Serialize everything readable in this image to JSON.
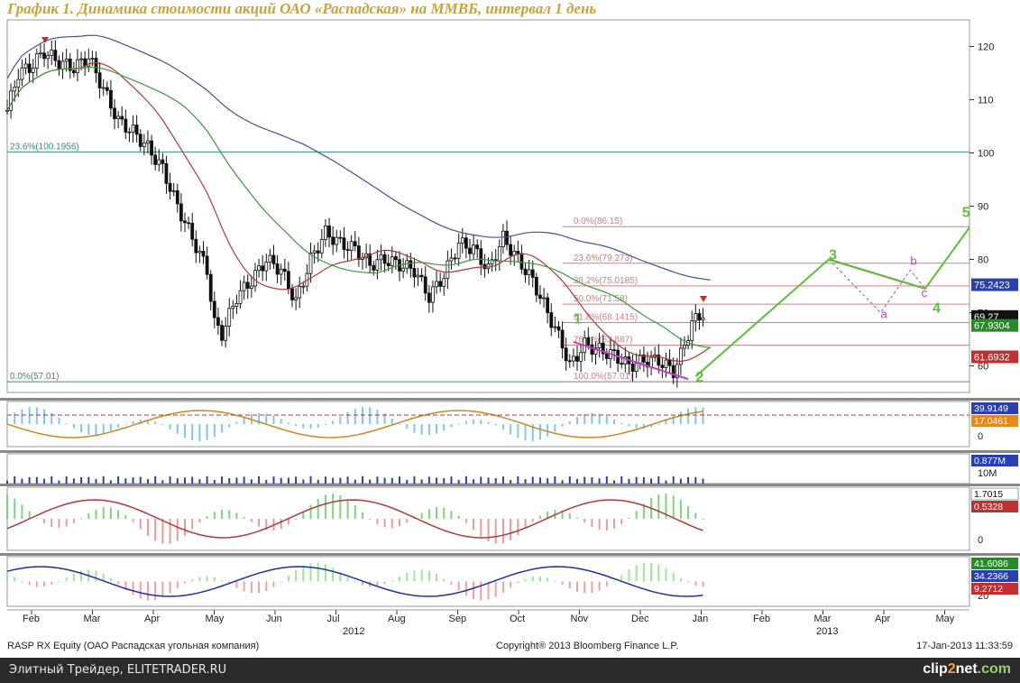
{
  "title": "График 1.   Динамика стоимости акций ОАО «Распадская» на ММВБ, интервал 1 день",
  "info": {
    "security": "RASP RX Equity (ОАО Распадская угольная компания)",
    "copyright": "Copyright® 2013 Bloomberg Finance L.P.",
    "timestamp": "17-Jan-2013 11:33:59"
  },
  "footer": {
    "left": "Элитный Трейдер, ELITETRADER.RU",
    "brand_a": "clip",
    "brand_b": "2",
    "brand_c": "net",
    "brand_d": ".com"
  },
  "colors": {
    "candle": "#111111",
    "ma_short": "#b03a3a",
    "ma_mid": "#3a9a3a",
    "ma_long": "#4050a0",
    "fib": "#d08080",
    "wave": "#5cbf3a",
    "alt_wave": "#c040c0",
    "level_line": "#3a8a8a",
    "tag_blue": "#2a40b0",
    "tag_red": "#c03030",
    "tag_green": "#2a8a2a",
    "tag_orange": "#e08a20"
  },
  "chart_data": {
    "type": "candlestick",
    "price_axis": {
      "ylim": [
        55,
        125
      ],
      "ticks": [
        60,
        70,
        80,
        90,
        100,
        110,
        120
      ]
    },
    "month_labels": [
      "Feb",
      "Mar",
      "Apr",
      "May",
      "Jun",
      "Jul",
      "Aug",
      "Sep",
      "Oct",
      "Nov",
      "Dec",
      "Jan",
      "Feb",
      "Mar",
      "Apr",
      "May"
    ],
    "year_labels": [
      "2012",
      "2013"
    ],
    "close_path": [
      [
        0,
        108
      ],
      [
        3,
        115
      ],
      [
        6,
        116
      ],
      [
        10,
        119
      ],
      [
        14,
        117
      ],
      [
        18,
        116
      ],
      [
        22,
        118
      ],
      [
        26,
        112
      ],
      [
        30,
        106
      ],
      [
        34,
        104
      ],
      [
        38,
        101
      ],
      [
        42,
        97
      ],
      [
        46,
        90
      ],
      [
        50,
        84
      ],
      [
        54,
        78
      ],
      [
        56,
        68
      ],
      [
        58,
        66
      ],
      [
        62,
        73
      ],
      [
        66,
        76
      ],
      [
        70,
        80
      ],
      [
        74,
        78
      ],
      [
        78,
        72
      ],
      [
        82,
        80
      ],
      [
        86,
        85
      ],
      [
        90,
        83
      ],
      [
        94,
        82
      ],
      [
        98,
        79
      ],
      [
        102,
        80
      ],
      [
        106,
        79
      ],
      [
        110,
        78
      ],
      [
        114,
        73
      ],
      [
        118,
        77
      ],
      [
        122,
        83
      ],
      [
        126,
        82
      ],
      [
        130,
        78
      ],
      [
        134,
        84
      ],
      [
        138,
        80
      ],
      [
        142,
        76
      ],
      [
        146,
        70
      ],
      [
        150,
        64
      ],
      [
        152,
        60
      ],
      [
        156,
        64
      ],
      [
        160,
        63
      ],
      [
        164,
        62
      ],
      [
        168,
        60
      ],
      [
        172,
        61
      ],
      [
        176,
        61
      ],
      [
        180,
        59
      ],
      [
        182,
        62
      ],
      [
        185,
        68
      ],
      [
        188,
        70
      ]
    ],
    "candle_dates": [
      0,
      188
    ],
    "horizontal_levels": [
      {
        "label": "23.6%(100.1956)",
        "value": 100.1956
      },
      {
        "label": "0.0%(57.01)",
        "value": 57.01
      }
    ],
    "fib_levels": [
      {
        "label": "0.0%(86.15)",
        "value": 86.15
      },
      {
        "label": "23.6%(79.273)",
        "value": 79.273
      },
      {
        "label": "38.2%(75.0185)",
        "value": 75.0185
      },
      {
        "label": "50.0%(71.58)",
        "value": 71.58
      },
      {
        "label": "61.8%(68.1415)",
        "value": 68.1415
      },
      {
        "label": "76.4%(63.887)",
        "value": 63.887
      },
      {
        "label": "100.0%(57.01)",
        "value": 57.01
      }
    ],
    "wave_labels": [
      {
        "label": "1",
        "x": 153,
        "y": 68
      },
      {
        "label": "2",
        "x": 186,
        "y": 57
      },
      {
        "label": "3",
        "x": 222,
        "y": 80
      },
      {
        "label": "4",
        "x": 250,
        "y": 70
      },
      {
        "label": "5",
        "x": 258,
        "y": 88
      }
    ],
    "wave_path": [
      [
        186,
        58
      ],
      [
        222,
        80
      ],
      [
        248,
        74.5
      ],
      [
        260,
        86
      ]
    ],
    "abc_labels": [
      {
        "label": "a",
        "x": 236,
        "y": 69
      },
      {
        "label": "b",
        "x": 244,
        "y": 79
      },
      {
        "label": "c",
        "x": 247,
        "y": 73
      }
    ],
    "price_tags": [
      {
        "text": "75.2423",
        "value": 75.2423,
        "color": "#2a40b0"
      },
      {
        "text": "69.27",
        "value": 69.27,
        "color": "#111111"
      },
      {
        "text": "67.9304",
        "value": 67.6,
        "color": "#2a8a2a"
      },
      {
        "text": "61.6932",
        "value": 61.6932,
        "color": "#c03030"
      }
    ],
    "panels": [
      {
        "name": "rsi",
        "tags": [
          {
            "text": "39.9149",
            "color": "#2a40b0"
          },
          {
            "text": "17.0461",
            "color": "#e08a20"
          }
        ],
        "axis_label": "0"
      },
      {
        "name": "volume",
        "tags": [
          {
            "text": "0.877M",
            "color": "#2a40b0"
          }
        ],
        "axis_label": "10M"
      },
      {
        "name": "macd",
        "tags": [
          {
            "text": "1.7015",
            "color": "#ffffff"
          },
          {
            "text": "0.5328",
            "color": "#c03030"
          }
        ],
        "axis_label": "0"
      },
      {
        "name": "dmi",
        "tags": [
          {
            "text": "41.6086",
            "color": "#2a8a2a"
          },
          {
            "text": "34.2366",
            "color": "#2a40b0"
          },
          {
            "text": "9.2712",
            "color": "#c03030"
          }
        ],
        "axis_label": "20"
      }
    ]
  }
}
